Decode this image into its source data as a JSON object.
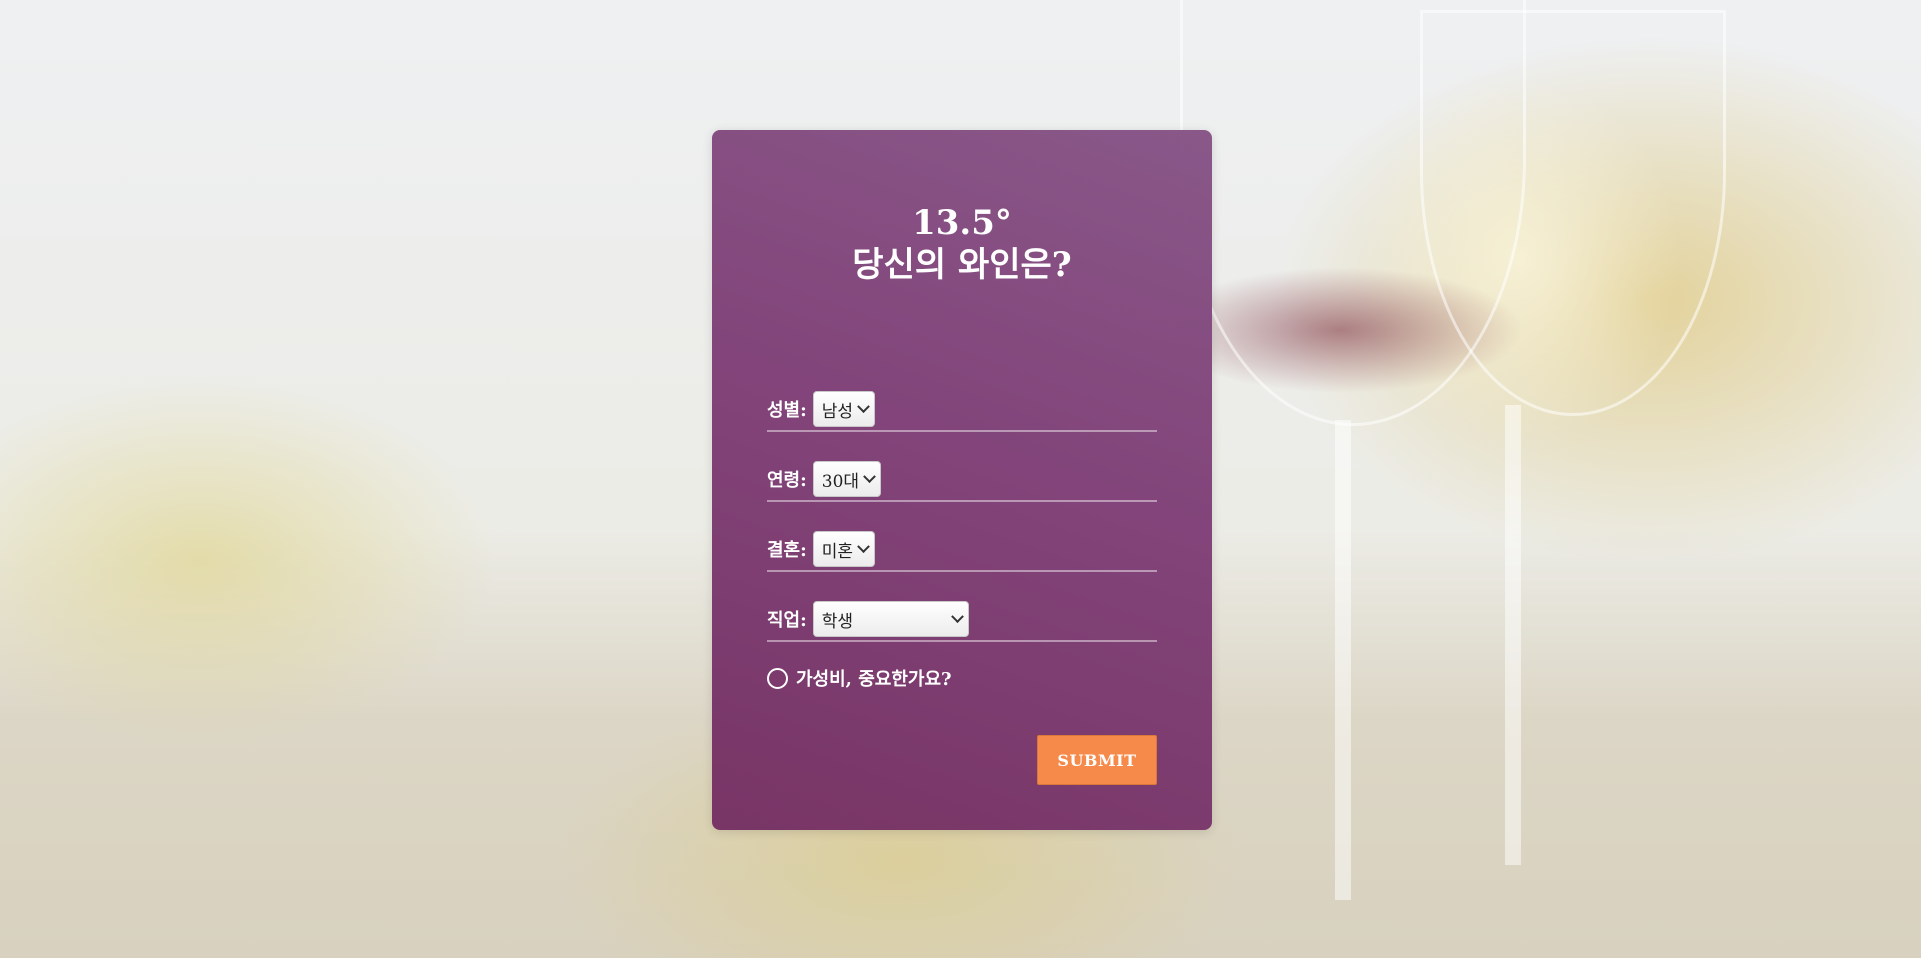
{
  "title": {
    "line1": "13.5°",
    "line2": "당신의 와인은?"
  },
  "form": {
    "gender": {
      "label": "성별:",
      "value": "남성"
    },
    "age": {
      "label": "연령:",
      "value": "30대"
    },
    "marriage": {
      "label": "결혼:",
      "value": "미혼"
    },
    "job": {
      "label": "직업:",
      "value": "학생"
    },
    "value_question": "가성비, 중요한가요?",
    "submit_label": "SUBMIT"
  },
  "colors": {
    "card": "#7f4478",
    "submit": "#f58a4b"
  }
}
